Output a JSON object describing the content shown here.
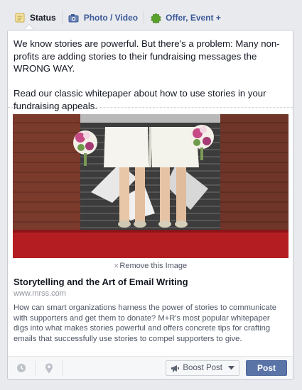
{
  "tabs": [
    {
      "label": "Status",
      "icon": "status-note-icon",
      "active": true
    },
    {
      "label": "Photo / Video",
      "icon": "camera-icon",
      "active": false
    },
    {
      "label": "Offer, Event +",
      "icon": "offer-star-icon",
      "active": false
    }
  ],
  "composer": {
    "status_text": "We know stories are powerful. But there's a problem: Many non-profits are adding stories to their fundraising messages the WRONG WAY.\n\nRead our classic whitepaper about how to use stories in your fundraising appeals."
  },
  "attachment": {
    "remove_label": "Remove this Image",
    "title": "Storytelling and the Art of Email Writing",
    "domain": "www.mrss.com",
    "description": "How can smart organizations harness the power of stories to communicate with supporters and get them to donate? M+R's most popular whitepaper digs into what makes stories powerful and offers concrete tips for crafting emails that successfully use stories to compel supporters to give."
  },
  "footer": {
    "boost_label": "Boost Post",
    "post_label": "Post",
    "icons": [
      "clock-icon",
      "location-pin-icon"
    ]
  },
  "colors": {
    "link_blue": "#3b5998",
    "post_button": "#5b74a8",
    "offer_green": "#5aa02c"
  }
}
